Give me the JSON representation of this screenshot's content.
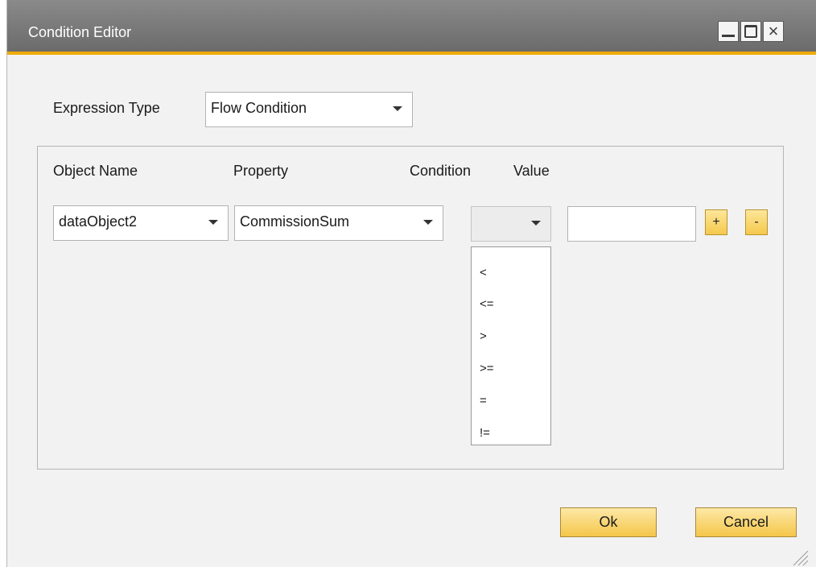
{
  "window": {
    "title": "Condition Editor",
    "controls": {
      "minimize": "minimize-icon",
      "maximize": "maximize-icon",
      "close": "×"
    }
  },
  "expression": {
    "label": "Expression Type",
    "value": "Flow Condition"
  },
  "columns": {
    "object_name": "Object Name",
    "property": "Property",
    "condition": "Condition",
    "value": "Value"
  },
  "row": {
    "object_name": "dataObject2",
    "property": "CommissionSum",
    "condition": "",
    "value": "",
    "add_label": "+",
    "remove_label": "-"
  },
  "condition_options": [
    "<",
    "<=",
    ">",
    ">=",
    "=",
    "!="
  ],
  "buttons": {
    "ok": "Ok",
    "cancel": "Cancel"
  },
  "colors": {
    "accent": "#f0ab00",
    "titlebar": "#7a7a7a",
    "button": "#f5c64a"
  }
}
